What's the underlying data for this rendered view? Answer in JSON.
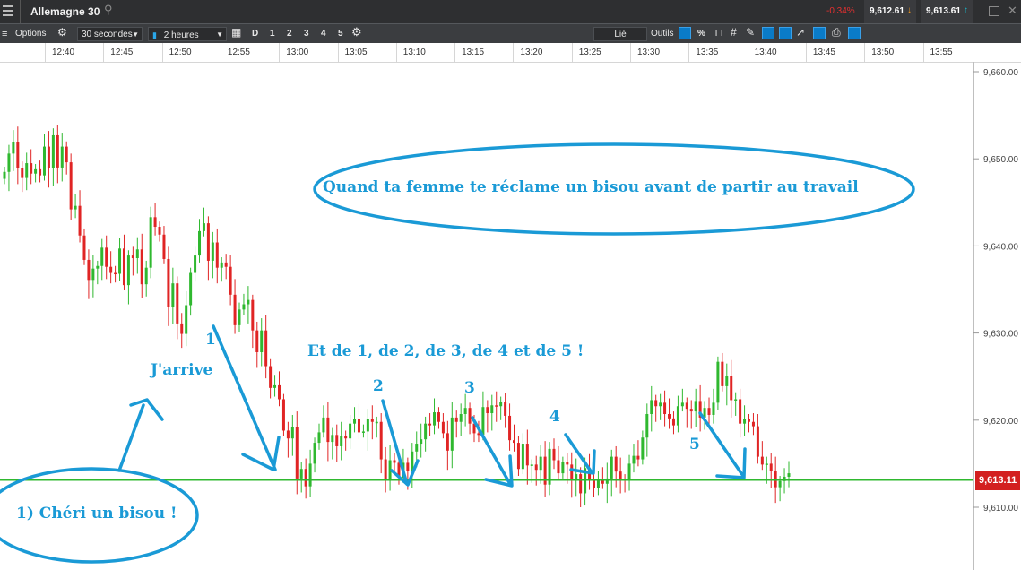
{
  "window": {
    "instrument": "Allemagne 30",
    "change": "-0.34%",
    "sell_price": "9,612.61",
    "buy_price": "9,613.61"
  },
  "toolbar": {
    "options_label": "Options",
    "interval_value": "30 secondes",
    "period_value": "2 heures",
    "day_label": "D",
    "quick_periods": [
      "1",
      "2",
      "3",
      "4",
      "5"
    ],
    "linked_label": "Lié",
    "tools_label": "Outils",
    "percent_label": "%",
    "text_tool_label": "TT"
  },
  "chart_data": {
    "type": "candlestick",
    "time_ticks": [
      "12:40",
      "12:45",
      "12:50",
      "12:55",
      "13:00",
      "13:05",
      "13:10",
      "13:15",
      "13:20",
      "13:25",
      "13:30",
      "13:35",
      "13:40",
      "13:45",
      "13:50",
      "13:55"
    ],
    "y_ticks": [
      "9,660.00",
      "9,650.00",
      "9,640.00",
      "9,630.00",
      "9,620.00",
      "9,610.00"
    ],
    "ylim": [
      9606,
      9666
    ],
    "current_price": 9613.11,
    "current_price_label": "9,613.11",
    "up_color": "#2fb82f",
    "down_color": "#e02424",
    "close": [
      9648.5,
      9650.6,
      9651.9,
      9648.9,
      9647.8,
      9649.5,
      9648.3,
      9648.8,
      9648.1,
      9651.4,
      9648.9,
      9652.7,
      9649.0,
      9651.4,
      9649.6,
      9644.2,
      9644.6,
      9641.2,
      9638.4,
      9636.1,
      9637.4,
      9637.7,
      9639.8,
      9637.6,
      9636.9,
      9636.8,
      9639.7,
      9635.5,
      9638.9,
      9638.6,
      9639.6,
      9635.6,
      9637.5,
      9643.3,
      9642.2,
      9641.3,
      9638.5,
      9633.0,
      9635.7,
      9631.1,
      9629.9,
      9633.2,
      9636.9,
      9638.9,
      9641.7,
      9642.6,
      9638.3,
      9640.4,
      9637.5,
      9638.1,
      9637.6,
      9634.4,
      9630.9,
      9632.7,
      9633.3,
      9633.8,
      9630.3,
      9627.8,
      9630.3,
      9626.2,
      9623.7,
      9624.0,
      9622.4,
      9618.8,
      9617.9,
      9619.2,
      9613.3,
      9614.4,
      9612.4,
      9615.0,
      9617.4,
      9618.6,
      9620.3,
      9617.5,
      9618.3,
      9617.0,
      9618.2,
      9617.9,
      9619.6,
      9620.1,
      9618.6,
      9618.7,
      9620.1,
      9619.8,
      9619.8,
      9615.5,
      9613.1,
      9615.4,
      9615.1,
      9613.4,
      9615.1,
      9614.2,
      9616.4,
      9617.3,
      9617.8,
      9619.6,
      9619.4,
      9620.9,
      9619.8,
      9618.5,
      9616.5,
      9620.3,
      9619.8,
      9620.7,
      9621.4,
      9619.6,
      9618.5,
      9618.3,
      9621.5,
      9620.8,
      9621.7,
      9621.6,
      9622.1,
      9620.5,
      9617.7,
      9617.4,
      9614.4,
      9617.3,
      9614.8,
      9614.9,
      9614.3,
      9615.8,
      9612.6,
      9616.7,
      9615.4,
      9613.9,
      9615.2,
      9614.9,
      9613.1,
      9613.8,
      9611.6,
      9614.5,
      9613.2,
      9612.2,
      9613.2,
      9612.7,
      9613.3,
      9615.8,
      9614.1,
      9613.2,
      9613.1,
      9615.0,
      9615.9,
      9615.5,
      9618.0,
      9620.7,
      9622.3,
      9621.6,
      9622.0,
      9620.7,
      9620.2,
      9619.4,
      9621.6,
      9622.0,
      9621.3,
      9621.0,
      9622.2,
      9620.3,
      9621.4,
      9620.6,
      9622.0,
      9626.7,
      9623.9,
      9625.1,
      9622.3,
      9622.4,
      9619.6,
      9620.1,
      9619.8,
      9619.3,
      9615.8,
      9614.9,
      9615.0,
      9614.2,
      9612.3,
      9613.0,
      9613.5,
      9613.9
    ]
  },
  "annotations": {
    "ellipse_main": "Quand ta femme te réclame un bisou avant de partir au travail",
    "ellipse_bottom": "1) Chéri un bisou !",
    "arrive": "J'arrive",
    "count_line": "Et de 1, de 2, de 3, de 4 et de 5 !",
    "n1": "1",
    "n2": "2",
    "n3": "3",
    "n4": "4",
    "n5": "5",
    "color": "#1a9ad6"
  }
}
